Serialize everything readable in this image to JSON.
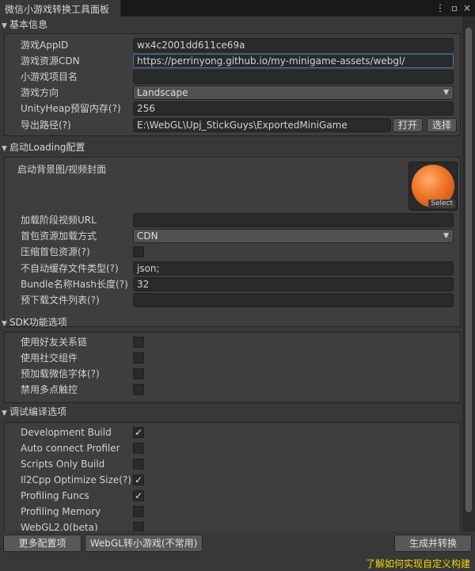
{
  "window": {
    "tab_title": "微信小游戏转换工具面板",
    "menu_icon": "kebab-menu-icon",
    "maximize_icon": "maximize-icon"
  },
  "sections": {
    "basic": {
      "title": "基本信息",
      "fields": {
        "appid_label": "游戏AppID",
        "appid_value": "wx4c2001dd611ce69a",
        "cdn_label": "游戏资源CDN",
        "cdn_value": "https://perrinyong.github.io/my-minigame-assets/webgl/",
        "project_name_label": "小游戏项目名",
        "project_name_value": "",
        "orientation_label": "游戏方向",
        "orientation_value": "Landscape",
        "heap_label": "UnityHeap预留内存(?)",
        "heap_value": "256",
        "export_path_label": "导出路径(?)",
        "export_path_value": "E:\\WebGL\\Upj_StickGuys\\ExportedMiniGame",
        "open_label": "打开",
        "choose_label": "选择"
      }
    },
    "loading": {
      "title": "启动Loading配置",
      "fields": {
        "bg_label": "启动背景图/视频封面",
        "select_label": "Select",
        "video_url_label": "加载阶段视频URL",
        "video_url_value": "",
        "first_pkg_label": "首包资源加载方式",
        "first_pkg_value": "CDN",
        "compress_label": "压缩首包资源(?)",
        "no_cache_label": "不自动缓存文件类型(?)",
        "no_cache_value": "json;",
        "hash_len_label": "Bundle名称Hash长度(?)",
        "hash_len_value": "32",
        "preload_label": "预下载文件列表(?)",
        "preload_value": ""
      }
    },
    "sdk": {
      "title": "SDK功能选项",
      "fields": {
        "friend_chain_label": "使用好友关系链",
        "social_label": "使用社交组件",
        "wx_font_label": "预加载微信字体(?)",
        "multitouch_label": "禁用多点触控"
      }
    },
    "debug": {
      "title": "调试编译选项",
      "fields": {
        "dev_build_label": "Development Build",
        "auto_profiler_label": "Auto connect Profiler",
        "scripts_only_label": "Scripts Only Build",
        "il2cpp_label": "Il2Cpp Optimize Size(?)",
        "profiling_funcs_label": "Profiling Funcs",
        "profiling_mem_label": "Profiling Memory",
        "webgl2_label": "WebGL2.0(beta)"
      }
    }
  },
  "toggles": {
    "compress": false,
    "friend_chain": false,
    "social": false,
    "wx_font": false,
    "multitouch": false,
    "dev_build": true,
    "auto_profiler": false,
    "scripts_only": false,
    "il2cpp": true,
    "profiling_funcs": true,
    "profiling_mem": false,
    "webgl2": false
  },
  "toolbar": {
    "more_config": "更多配置项",
    "webgl_convert": "WebGL转小游戏(不常用)",
    "generate": "生成并转换",
    "custom_build_link": "了解如何实现自定义构建"
  },
  "colors": {
    "link": "#f0d800",
    "focus_border": "#3a79bb"
  }
}
